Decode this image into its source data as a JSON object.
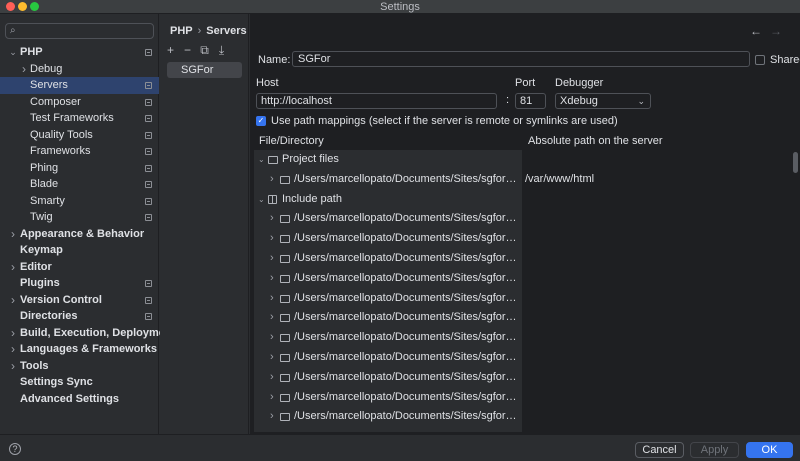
{
  "window": {
    "title": "Settings"
  },
  "search": {
    "placeholder": ""
  },
  "nav": {
    "items": [
      {
        "label": "PHP",
        "level": 0,
        "chevron": "expanded",
        "bold": true,
        "square": true,
        "selected": false
      },
      {
        "label": "Debug",
        "level": 1,
        "chevron": "collapsed",
        "bold": false,
        "square": false,
        "selected": false
      },
      {
        "label": "Servers",
        "level": 1,
        "chevron": "",
        "bold": false,
        "square": true,
        "selected": true
      },
      {
        "label": "Composer",
        "level": 1,
        "chevron": "",
        "bold": false,
        "square": true,
        "selected": false
      },
      {
        "label": "Test Frameworks",
        "level": 1,
        "chevron": "",
        "bold": false,
        "square": true,
        "selected": false
      },
      {
        "label": "Quality Tools",
        "level": 1,
        "chevron": "",
        "bold": false,
        "square": true,
        "selected": false
      },
      {
        "label": "Frameworks",
        "level": 1,
        "chevron": "",
        "bold": false,
        "square": true,
        "selected": false
      },
      {
        "label": "Phing",
        "level": 1,
        "chevron": "",
        "bold": false,
        "square": true,
        "selected": false
      },
      {
        "label": "Blade",
        "level": 1,
        "chevron": "",
        "bold": false,
        "square": true,
        "selected": false
      },
      {
        "label": "Smarty",
        "level": 1,
        "chevron": "",
        "bold": false,
        "square": true,
        "selected": false
      },
      {
        "label": "Twig",
        "level": 1,
        "chevron": "",
        "bold": false,
        "square": true,
        "selected": false
      },
      {
        "label": "Appearance & Behavior",
        "level": 0,
        "chevron": "collapsed",
        "bold": true,
        "square": false,
        "selected": false
      },
      {
        "label": "Keymap",
        "level": 0,
        "chevron": "",
        "bold": true,
        "square": false,
        "selected": false
      },
      {
        "label": "Editor",
        "level": 0,
        "chevron": "collapsed",
        "bold": true,
        "square": false,
        "selected": false
      },
      {
        "label": "Plugins",
        "level": 0,
        "chevron": "",
        "bold": true,
        "square": true,
        "selected": false
      },
      {
        "label": "Version Control",
        "level": 0,
        "chevron": "collapsed",
        "bold": true,
        "square": true,
        "selected": false
      },
      {
        "label": "Directories",
        "level": 0,
        "chevron": "",
        "bold": true,
        "square": true,
        "selected": false
      },
      {
        "label": "Build, Execution, Deployment",
        "level": 0,
        "chevron": "collapsed",
        "bold": true,
        "square": false,
        "selected": false
      },
      {
        "label": "Languages & Frameworks",
        "level": 0,
        "chevron": "collapsed",
        "bold": true,
        "square": false,
        "selected": false
      },
      {
        "label": "Tools",
        "level": 0,
        "chevron": "collapsed",
        "bold": true,
        "square": false,
        "selected": false
      },
      {
        "label": "Settings Sync",
        "level": 0,
        "chevron": "",
        "bold": true,
        "square": false,
        "selected": false
      },
      {
        "label": "Advanced Settings",
        "level": 0,
        "chevron": "",
        "bold": true,
        "square": false,
        "selected": false
      }
    ]
  },
  "breadcrumb": {
    "parent": "PHP",
    "separator": "›",
    "current": "Servers"
  },
  "servers": {
    "items": [
      "SGFor"
    ]
  },
  "form": {
    "name_label": "Name:",
    "name_value": "SGFor",
    "shared_label": "Shared",
    "host_label": "Host",
    "host_value": "http://localhost",
    "colon": ":",
    "port_label": "Port",
    "port_value": "81",
    "debugger_label": "Debugger",
    "debugger_value": "Xdebug",
    "path_mappings_label": "Use path mappings (select if the server is remote or symlinks are used)"
  },
  "table": {
    "col_file": "File/Directory",
    "col_abs": "Absolute path on the server",
    "rows": [
      {
        "text": "Project files",
        "type": "group",
        "icon": "folder",
        "chevron": "expanded",
        "abs": ""
      },
      {
        "text": "/Users/marcellopato/Documents/Sites/sgfor_back",
        "type": "child",
        "icon": "folder",
        "chevron": "collapsed",
        "abs": "/var/www/html"
      },
      {
        "text": "Include path",
        "type": "group",
        "icon": "include",
        "chevron": "expanded",
        "abs": ""
      },
      {
        "text": "/Users/marcellopato/Documents/Sites/sgfor_back/ve...",
        "type": "child",
        "icon": "folder",
        "chevron": "collapsed",
        "abs": ""
      },
      {
        "text": "/Users/marcellopato/Documents/Sites/sgfor_back/ve...",
        "type": "child",
        "icon": "folder",
        "chevron": "collapsed",
        "abs": ""
      },
      {
        "text": "/Users/marcellopato/Documents/Sites/sgfor_back/ve...",
        "type": "child",
        "icon": "folder",
        "chevron": "collapsed",
        "abs": ""
      },
      {
        "text": "/Users/marcellopato/Documents/Sites/sgfor_back/ve...",
        "type": "child",
        "icon": "folder",
        "chevron": "collapsed",
        "abs": ""
      },
      {
        "text": "/Users/marcellopato/Documents/Sites/sgfor_back/ve...",
        "type": "child",
        "icon": "folder",
        "chevron": "collapsed",
        "abs": ""
      },
      {
        "text": "/Users/marcellopato/Documents/Sites/sgfor_back/ve...",
        "type": "child",
        "icon": "folder",
        "chevron": "collapsed",
        "abs": ""
      },
      {
        "text": "/Users/marcellopato/Documents/Sites/sgfor_back/ve...",
        "type": "child",
        "icon": "folder",
        "chevron": "collapsed",
        "abs": ""
      },
      {
        "text": "/Users/marcellopato/Documents/Sites/sgfor_back/ve...",
        "type": "child",
        "icon": "folder",
        "chevron": "collapsed",
        "abs": ""
      },
      {
        "text": "/Users/marcellopato/Documents/Sites/sgfor_back/ve...",
        "type": "child",
        "icon": "folder",
        "chevron": "collapsed",
        "abs": ""
      },
      {
        "text": "/Users/marcellopato/Documents/Sites/sgfor_back/ve...",
        "type": "child",
        "icon": "folder",
        "chevron": "collapsed",
        "abs": ""
      },
      {
        "text": "/Users/marcellopato/Documents/Sites/sgfor_back/ve...",
        "type": "child",
        "icon": "folder",
        "chevron": "collapsed",
        "abs": ""
      }
    ]
  },
  "buttons": {
    "help": "?",
    "cancel": "Cancel",
    "apply": "Apply",
    "ok": "OK"
  },
  "colors": {
    "accent": "#3574f0",
    "selection": "#2e436e"
  }
}
